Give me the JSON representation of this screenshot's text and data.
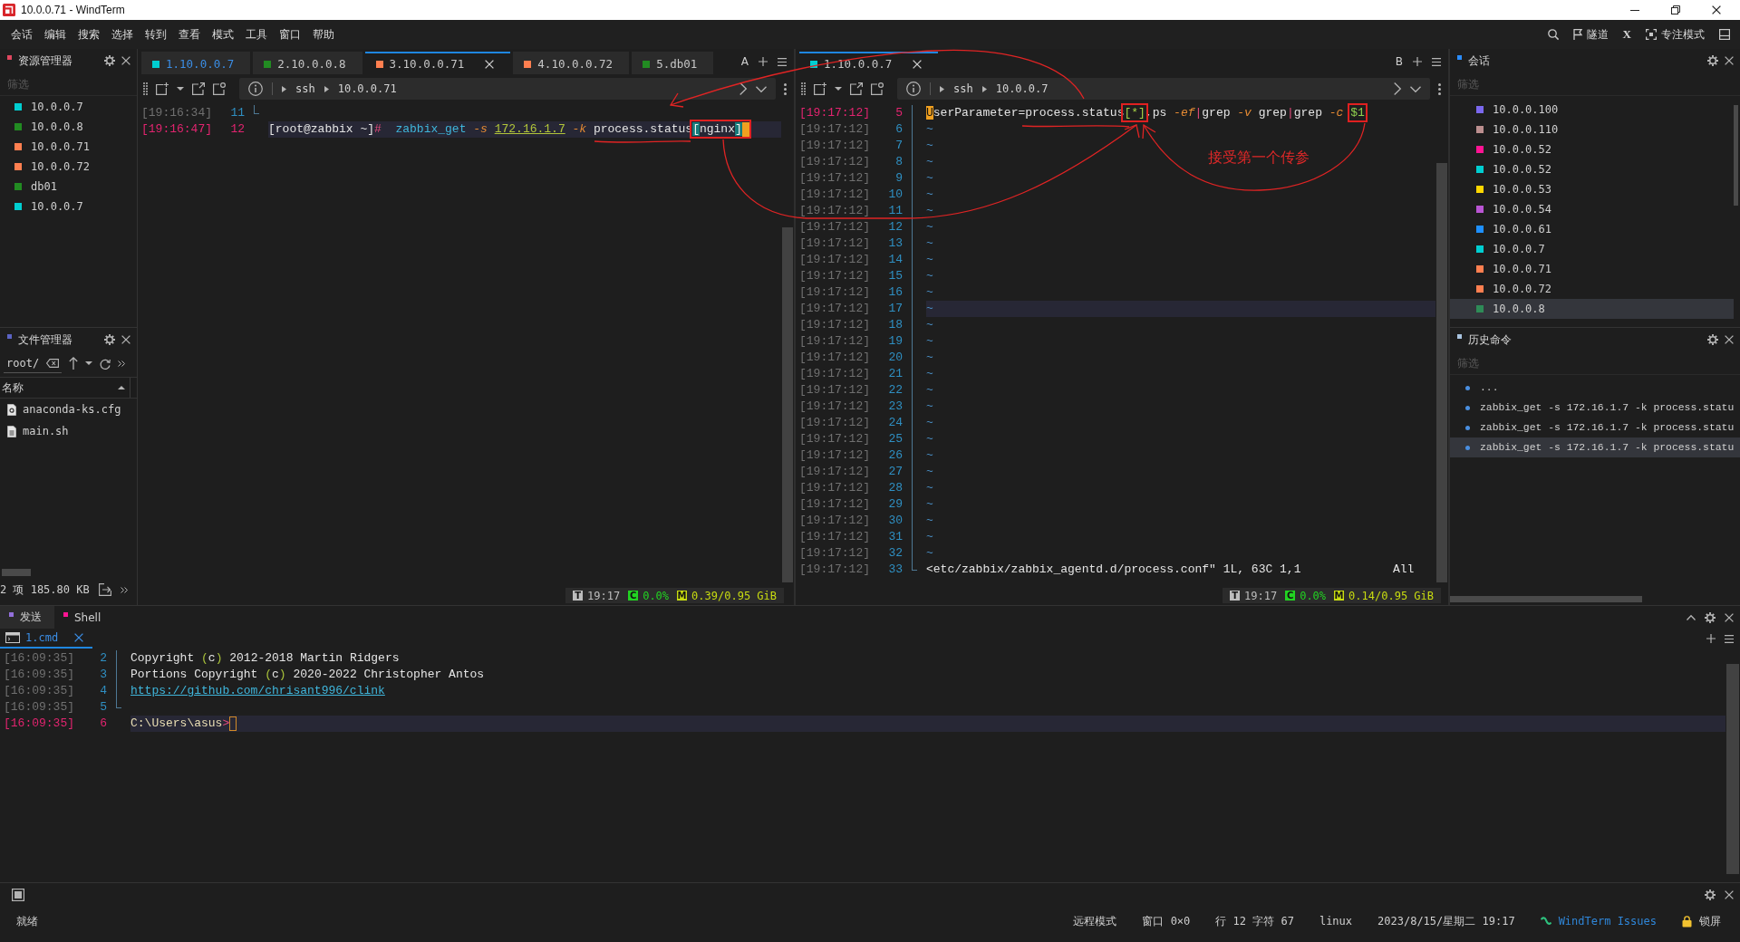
{
  "window": {
    "title": "10.0.0.71 - WindTerm"
  },
  "menu": [
    "会话",
    "编辑",
    "搜索",
    "选择",
    "转到",
    "查看",
    "模式",
    "工具",
    "窗口",
    "帮助"
  ],
  "toolbar": [
    {
      "kind": "search"
    },
    {
      "kind": "tunnel",
      "label": "隧道"
    },
    {
      "kind": "x",
      "label": "X"
    },
    {
      "kind": "focus",
      "label": "专注模式"
    },
    {
      "kind": "layout"
    }
  ],
  "explorer": {
    "title": "资源管理器",
    "placeholder": "筛选",
    "items": [
      {
        "label": "10.0.0.7",
        "color": "#00ced1"
      },
      {
        "label": "10.0.0.8",
        "color": "#228b22"
      },
      {
        "label": "10.0.0.71",
        "color": "#ff7f50"
      },
      {
        "label": "10.0.0.72",
        "color": "#ff7f50"
      },
      {
        "label": "db01",
        "color": "#228b22"
      },
      {
        "label": "10.0.0.7",
        "color": "#00ced1"
      }
    ]
  },
  "file_manager": {
    "title": "文件管理器",
    "path": "root/",
    "column": "名称",
    "files": [
      {
        "name": "anaconda-ks.cfg",
        "kind": "config"
      },
      {
        "name": "main.sh",
        "kind": "script"
      }
    ],
    "footer": "2 项 185.80 KB"
  },
  "panes": [
    {
      "group": "A",
      "tabs": [
        {
          "label": "1.10.0.0.7",
          "color": "#00ced1",
          "selected": false,
          "highlighted": true
        },
        {
          "label": "2.10.0.0.8",
          "color": "#228b22",
          "selected": false,
          "highlighted": false
        },
        {
          "label": "3.10.0.0.71",
          "color": "#ff7f50",
          "selected": true,
          "highlighted": false
        },
        {
          "label": "4.10.0.0.72",
          "color": "#ff7f50",
          "selected": false,
          "highlighted": false
        },
        {
          "label": "5.db01",
          "color": "#228b22",
          "selected": false,
          "highlighted": false
        }
      ],
      "breadcrumb": [
        "ssh",
        "10.0.0.71"
      ],
      "lines": [
        {
          "kind": "fold",
          "children": [
            {
              "time": "[19:16:34]",
              "number": "11",
              "current": false,
              "highlighted": false
            }
          ]
        },
        {
          "kind": "line",
          "time": "[19:16:47]",
          "number": "12",
          "current": true,
          "highlighted": true,
          "segments": [
            {
              "text": "[root@zabbix ~]",
              "kind": "prompt"
            },
            {
              "text": "#  ",
              "kind": "sign"
            },
            {
              "text": "zabbix_get ",
              "kind": "command"
            },
            {
              "text": "-s ",
              "kind": "option"
            },
            {
              "text": "172.16.1.7",
              "kind": "address"
            },
            {
              "text": " -k ",
              "kind": "option"
            },
            {
              "text": "process.status",
              "kind": "text"
            },
            {
              "kind": "box",
              "children": [
                {
                  "text": "[",
                  "kind": "match"
                },
                {
                  "text": "nginx",
                  "kind": "text"
                },
                {
                  "text": "]",
                  "kind": "match"
                },
                {
                  "kind": "cursor"
                }
              ]
            }
          ]
        }
      ],
      "status": [
        {
          "kind": "time",
          "badge": "T",
          "value": "19:17"
        },
        {
          "kind": "cpu",
          "badge": "C",
          "value": "0.0%"
        },
        {
          "kind": "memory",
          "badge": "M",
          "value": "0.39/0.95 GiB"
        }
      ]
    },
    {
      "group": "B",
      "tabs": [
        {
          "label": "1.10.0.0.7",
          "color": "#00ced1",
          "selected": true,
          "highlighted": false
        }
      ],
      "breadcrumb": [
        "ssh",
        "10.0.0.7"
      ],
      "lines": [
        {
          "kind": "fold",
          "children": [
            {
              "time": "[19:17:12]",
              "number": "5",
              "current": true,
              "highlighted": false,
              "segments": [
                {
                  "text": "U",
                  "kind": "cursor"
                },
                {
                  "text": "serParameter=process.status",
                  "kind": "text"
                },
                {
                  "kind": "box",
                  "children": [
                    {
                      "text": "[*]",
                      "kind": "glob"
                    }
                  ]
                },
                {
                  "text": ",ps ",
                  "kind": "text"
                },
                {
                  "text": "-ef",
                  "kind": "option"
                },
                {
                  "text": "|",
                  "kind": "pipe"
                },
                {
                  "text": "grep ",
                  "kind": "text"
                },
                {
                  "text": "-v ",
                  "kind": "option"
                },
                {
                  "text": "grep",
                  "kind": "text"
                },
                {
                  "text": "|",
                  "kind": "pipe"
                },
                {
                  "text": "grep ",
                  "kind": "text"
                },
                {
                  "text": "-c ",
                  "kind": "option"
                },
                {
                  "kind": "box",
                  "children": [
                    {
                      "text": "$1",
                      "kind": "variable"
                    }
                  ]
                }
              ]
            },
            {
              "time": "[19:17:12]",
              "number": "6",
              "current": false,
              "highlighted": false,
              "segments": [
                {
                  "text": "~",
                  "kind": "tilde"
                }
              ]
            },
            {
              "time": "[19:17:12]",
              "number": "7",
              "current": false,
              "highlighted": false,
              "segments": [
                {
                  "text": "~",
                  "kind": "tilde"
                }
              ]
            },
            {
              "time": "[19:17:12]",
              "number": "8",
              "current": false,
              "highlighted": false,
              "segments": [
                {
                  "text": "~",
                  "kind": "tilde"
                }
              ]
            },
            {
              "time": "[19:17:12]",
              "number": "9",
              "current": false,
              "highlighted": false,
              "segments": [
                {
                  "text": "~",
                  "kind": "tilde"
                }
              ]
            },
            {
              "time": "[19:17:12]",
              "number": "10",
              "current": false,
              "highlighted": false,
              "segments": [
                {
                  "text": "~",
                  "kind": "tilde"
                }
              ]
            },
            {
              "time": "[19:17:12]",
              "number": "11",
              "current": false,
              "highlighted": false,
              "segments": [
                {
                  "text": "~",
                  "kind": "tilde"
                }
              ]
            },
            {
              "time": "[19:17:12]",
              "number": "12",
              "current": false,
              "highlighted": false,
              "segments": [
                {
                  "text": "~",
                  "kind": "tilde"
                }
              ]
            },
            {
              "time": "[19:17:12]",
              "number": "13",
              "current": false,
              "highlighted": false,
              "segments": [
                {
                  "text": "~",
                  "kind": "tilde"
                }
              ]
            },
            {
              "time": "[19:17:12]",
              "number": "14",
              "current": false,
              "highlighted": false,
              "segments": [
                {
                  "text": "~",
                  "kind": "tilde"
                }
              ]
            },
            {
              "time": "[19:17:12]",
              "number": "15",
              "current": false,
              "highlighted": false,
              "segments": [
                {
                  "text": "~",
                  "kind": "tilde"
                }
              ]
            },
            {
              "time": "[19:17:12]",
              "number": "16",
              "current": false,
              "highlighted": false,
              "segments": [
                {
                  "text": "~",
                  "kind": "tilde"
                }
              ]
            },
            {
              "time": "[19:17:12]",
              "number": "17",
              "current": false,
              "highlighted": true,
              "segments": [
                {
                  "text": "~",
                  "kind": "tilde"
                }
              ]
            },
            {
              "time": "[19:17:12]",
              "number": "18",
              "current": false,
              "highlighted": false,
              "segments": [
                {
                  "text": "~",
                  "kind": "tilde"
                }
              ]
            },
            {
              "time": "[19:17:12]",
              "number": "19",
              "current": false,
              "highlighted": false,
              "segments": [
                {
                  "text": "~",
                  "kind": "tilde"
                }
              ]
            },
            {
              "time": "[19:17:12]",
              "number": "20",
              "current": false,
              "highlighted": false,
              "segments": [
                {
                  "text": "~",
                  "kind": "tilde"
                }
              ]
            },
            {
              "time": "[19:17:12]",
              "number": "21",
              "current": false,
              "highlighted": false,
              "segments": [
                {
                  "text": "~",
                  "kind": "tilde"
                }
              ]
            },
            {
              "time": "[19:17:12]",
              "number": "22",
              "current": false,
              "highlighted": false,
              "segments": [
                {
                  "text": "~",
                  "kind": "tilde"
                }
              ]
            },
            {
              "time": "[19:17:12]",
              "number": "23",
              "current": false,
              "highlighted": false,
              "segments": [
                {
                  "text": "~",
                  "kind": "tilde"
                }
              ]
            },
            {
              "time": "[19:17:12]",
              "number": "24",
              "current": false,
              "highlighted": false,
              "segments": [
                {
                  "text": "~",
                  "kind": "tilde"
                }
              ]
            },
            {
              "time": "[19:17:12]",
              "number": "25",
              "current": false,
              "highlighted": false,
              "segments": [
                {
                  "text": "~",
                  "kind": "tilde"
                }
              ]
            },
            {
              "time": "[19:17:12]",
              "number": "26",
              "current": false,
              "highlighted": false,
              "segments": [
                {
                  "text": "~",
                  "kind": "tilde"
                }
              ]
            },
            {
              "time": "[19:17:12]",
              "number": "27",
              "current": false,
              "highlighted": false,
              "segments": [
                {
                  "text": "~",
                  "kind": "tilde"
                }
              ]
            },
            {
              "time": "[19:17:12]",
              "number": "28",
              "current": false,
              "highlighted": false,
              "segments": [
                {
                  "text": "~",
                  "kind": "tilde"
                }
              ]
            },
            {
              "time": "[19:17:12]",
              "number": "29",
              "current": false,
              "highlighted": false,
              "segments": [
                {
                  "text": "~",
                  "kind": "tilde"
                }
              ]
            },
            {
              "time": "[19:17:12]",
              "number": "30",
              "current": false,
              "highlighted": false,
              "segments": [
                {
                  "text": "~",
                  "kind": "tilde"
                }
              ]
            },
            {
              "time": "[19:17:12]",
              "number": "31",
              "current": false,
              "highlighted": false,
              "segments": [
                {
                  "text": "~",
                  "kind": "tilde"
                }
              ]
            },
            {
              "time": "[19:17:12]",
              "number": "32",
              "current": false,
              "highlighted": false,
              "segments": [
                {
                  "text": "~",
                  "kind": "tilde"
                }
              ]
            },
            {
              "time": "[19:17:12]",
              "number": "33",
              "current": false,
              "highlighted": false,
              "segments": [
                {
                  "text": "<etc/zabbix/zabbix_agentd.d/process.conf\" 1L, 63C 1,1             All",
                  "kind": "text"
                }
              ]
            }
          ]
        }
      ],
      "status": [
        {
          "kind": "time",
          "badge": "T",
          "value": "19:17"
        },
        {
          "kind": "cpu",
          "badge": "C",
          "value": "0.0%"
        },
        {
          "kind": "memory",
          "badge": "M",
          "value": "0.14/0.95 GiB"
        }
      ]
    }
  ],
  "annotation": {
    "note": "接受第一个传参"
  },
  "sessions": {
    "title": "会话",
    "placeholder": "筛选",
    "items": [
      {
        "label": "10.0.0.100",
        "color": "#7b68ee",
        "selected": false
      },
      {
        "label": "10.0.0.110",
        "color": "#bc8f8f",
        "selected": false
      },
      {
        "label": "10.0.0.52",
        "color": "#ff1493",
        "selected": false
      },
      {
        "label": "10.0.0.52",
        "color": "#00ced1",
        "selected": false
      },
      {
        "label": "10.0.0.53",
        "color": "#ffd700",
        "selected": false
      },
      {
        "label": "10.0.0.54",
        "color": "#ba55d3",
        "selected": false
      },
      {
        "label": "10.0.0.61",
        "color": "#1e90ff",
        "selected": false
      },
      {
        "label": "10.0.0.7",
        "color": "#00ced1",
        "selected": false
      },
      {
        "label": "10.0.0.71",
        "color": "#ff7f50",
        "selected": false
      },
      {
        "label": "10.0.0.72",
        "color": "#ff7f50",
        "selected": false
      },
      {
        "label": "10.0.0.8",
        "color": "#2e8b57",
        "selected": true
      }
    ]
  },
  "history": {
    "title": "历史命令",
    "placeholder": "筛选",
    "items": [
      {
        "text": "...",
        "selected": false
      },
      {
        "text": "zabbix_get -s 172.16.1.7 -k process.statu",
        "selected": false
      },
      {
        "text": "zabbix_get -s 172.16.1.7 -k process.statu",
        "selected": false
      },
      {
        "text": "zabbix_get -s 172.16.1.7 -k process.statu",
        "selected": true
      }
    ]
  },
  "bottom_panel": {
    "tabs": [
      {
        "label": "发送",
        "color": "#9370db",
        "selected": false
      },
      {
        "label": "Shell",
        "color": "#ff1493",
        "selected": true
      }
    ],
    "subtabs": [
      {
        "label": "1.cmd",
        "selected": true
      }
    ],
    "lines": [
      {
        "kind": "fold",
        "children": [
          {
            "time": "[16:09:35]",
            "number": "2",
            "current": false,
            "highlighted": false,
            "segments": [
              {
                "text": "Copyright ",
                "kind": "text"
              },
              {
                "text": "(",
                "kind": "paren"
              },
              {
                "text": "c",
                "kind": "text"
              },
              {
                "text": ")",
                "kind": "paren"
              },
              {
                "text": " 2012-2018 Martin Ridgers",
                "kind": "text"
              }
            ]
          },
          {
            "time": "[16:09:35]",
            "number": "3",
            "current": false,
            "highlighted": false,
            "segments": [
              {
                "text": "Portions Copyright ",
                "kind": "text"
              },
              {
                "text": "(",
                "kind": "paren"
              },
              {
                "text": "c",
                "kind": "text"
              },
              {
                "text": ")",
                "kind": "paren"
              },
              {
                "text": " 2020-2022 Christopher Antos",
                "kind": "text"
              }
            ]
          },
          {
            "time": "[16:09:35]",
            "number": "4",
            "current": false,
            "highlighted": false,
            "segments": [
              {
                "text": "https://github.com/chrisant996/clink",
                "kind": "link"
              }
            ]
          },
          {
            "time": "[16:09:35]",
            "number": "5",
            "current": false,
            "highlighted": false
          }
        ]
      },
      {
        "kind": "line",
        "time": "[16:09:35]",
        "number": "6",
        "current": true,
        "highlighted": true,
        "segments": [
          {
            "text": "C:\\Users\\asus",
            "kind": "path"
          },
          {
            "text": ">",
            "kind": "sign"
          },
          {
            "kind": "cursor-outline"
          }
        ]
      }
    ]
  },
  "status_bar": {
    "message": "就绪",
    "items": [
      {
        "label": "远程模式",
        "kind": "text"
      },
      {
        "label": "窗口 0×0",
        "kind": "text"
      },
      {
        "label": "行 12 字符 67",
        "kind": "text"
      },
      {
        "label": "linux",
        "kind": "text"
      },
      {
        "label": "2023/8/15/星期二 19:17",
        "kind": "text"
      },
      {
        "label": "WindTerm Issues",
        "kind": "link"
      },
      {
        "label": "锁屏",
        "kind": "lock"
      }
    ]
  }
}
